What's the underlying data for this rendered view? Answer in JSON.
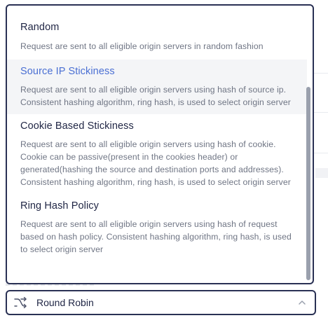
{
  "select": {
    "value": "Round Robin",
    "icon": "shuffle-icon",
    "expanded": true,
    "chevron": "chevron-up-icon"
  },
  "options": [
    {
      "title": "Random",
      "description": "Request are sent to all eligible origin servers in random fashion"
    },
    {
      "title": "Source IP Stickiness",
      "description": "Request are sent to all eligible origin servers using hash of source ip. Consistent hashing algorithm, ring hash, is used to select origin server"
    },
    {
      "title": "Cookie Based Stickiness",
      "description": "Request are sent to all eligible origin servers using hash of cookie. Cookie can be passive(present in the cookies header) or generated(hashing the source and destination ports and addresses). Consistent hashing algorithm, ring hash, is used to select origin server"
    },
    {
      "title": "Ring Hash Policy",
      "description": "Request are sent to all eligible origin servers using hash of request based on hash policy. Consistent hashing algorithm, ring hash, is used to select origin server"
    }
  ],
  "highlighted_index": 1,
  "colors": {
    "border": "#2a3154",
    "title": "#1f2544",
    "title_highlight": "#4a6fd3",
    "description": "#6f7584",
    "highlight_bg": "#f4f5f7",
    "scroll_thumb": "#9aa0ad"
  }
}
